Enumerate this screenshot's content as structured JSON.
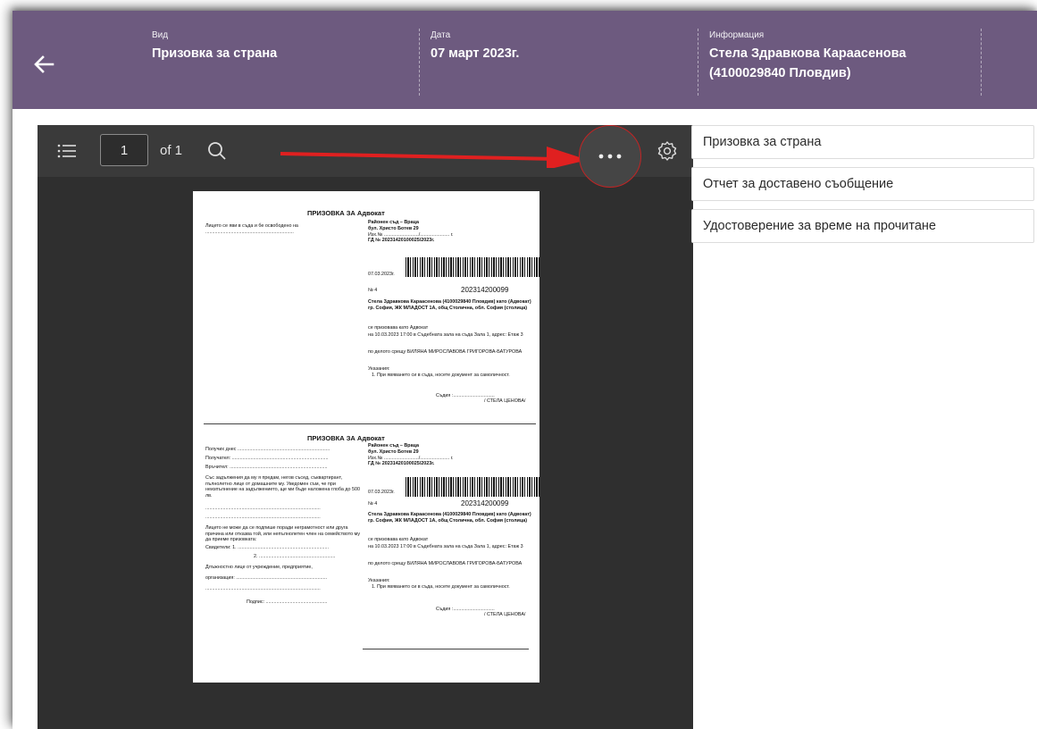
{
  "header": {
    "back_icon": "arrow-left-icon",
    "columns": [
      {
        "label": "Вид",
        "value": "Призовка за страна"
      },
      {
        "label": "Дата",
        "value": "07 март 2023г."
      },
      {
        "label": "Информация",
        "value_line1": "Стела Здравкова Караасенова",
        "value_line2": "(4100029840 Пловдив)"
      }
    ]
  },
  "viewer": {
    "page_current": "1",
    "page_total_label": "of 1",
    "icons": [
      "list-icon",
      "search-icon",
      "more-options-icon",
      "settings-icon"
    ],
    "document": {
      "copy1": {
        "title": "ПРИЗОВКА ЗА Адвокат",
        "left_text": "Лицето се яви в съда и бе освободено на ..................................................................",
        "court": "Районен съд – Враца",
        "address": "бул. Христо Ботев 29",
        "ref_line": "Изх.№ ........................../...................... г.",
        "case": "ГД № 20231420100025/2023г.",
        "date": "07.03.2023г.",
        "no_label": "№ 4",
        "barcode_number": "202314200099",
        "person": "Стела Здравкова Караасенова (4100029840 Пловдив) като (Адвокат) гр. София, ЖК МЛАДОСТ 1А, общ Столична, обл. София (столица)",
        "summoned_as": "се призовава като Адвокат",
        "hearing": "на 10.03.2023 17:00 в Съдебната зала на съда Зала 1, адрес: Етаж 3",
        "case_against": "по делото срещу БИЛЯНА МИРОСЛАВОВА ГРИГОРОВА-БАТУРОВА",
        "instructions_title": "Указания:",
        "instructions": "1. При явяването си в съда, носете документ за самоличност.",
        "judge": "Съдия :...............................",
        "judge_name": "/ СТЕЛА ЦЕНОВА/"
      },
      "copy2": {
        "title": "ПРИЗОВКА ЗА Адвокат",
        "received_today": "Получих днес .....................................................................",
        "recipient": "Получател: ........................................................................",
        "delivered_by": "Връчител: .........................................................................",
        "note1": "Със задължения да му я предам, негов съсед, съквартирант, пълнолетно лице от домашните му. Уведомен съм, че при неизпълнение на задължението, ще ми бъде наложена глоба до 500 лв.",
        "dots": "......................................................................................",
        "note2": "Лицето не може да се подпише поради неграмотност или друга причина или отказва той, или непълнолетен член на семейството му да приеме призовката:",
        "witness1": "Свидетели: 1. ....................................................................",
        "witness2": "2. .........................................................",
        "official": "Длъжностно лице от учреждение, предприятие,",
        "organization": "организация: ....................................................................",
        "signature": "Подпис: .............................................."
      }
    }
  },
  "sidebar": {
    "items": [
      {
        "label": "Призовка за страна"
      },
      {
        "label": "Отчет за доставено съобщение"
      },
      {
        "label": "Удостоверение за време на прочитане"
      }
    ]
  },
  "colors": {
    "header_bg": "#6d5a7f",
    "viewer_bg": "#2f2f2f",
    "toolbar_bg": "#3a3a3a",
    "annotation_arrow": "#e02020"
  }
}
